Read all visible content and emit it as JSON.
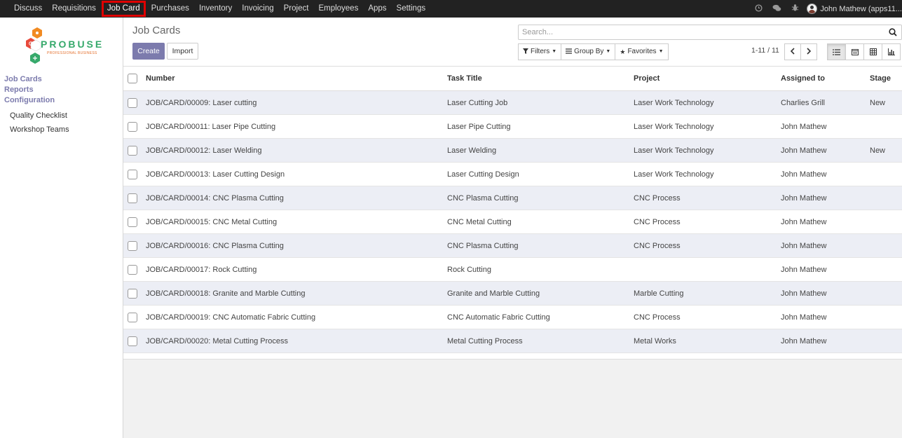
{
  "topbar": {
    "menu": [
      "Discuss",
      "Requisitions",
      "Job Card",
      "Purchases",
      "Inventory",
      "Invoicing",
      "Project",
      "Employees",
      "Apps",
      "Settings"
    ],
    "active_index": 2,
    "user_name": "John Mathew (apps11..."
  },
  "sidebar": {
    "logo": {
      "brand": "PROBUSE",
      "tagline": "PROFESSIONAL BUSINESS"
    },
    "main_items": [
      "Job Cards",
      "Reports",
      "Configuration"
    ],
    "sub_items": [
      "Quality Checklist",
      "Workshop Teams"
    ]
  },
  "control_panel": {
    "title": "Job Cards",
    "create_label": "Create",
    "import_label": "Import",
    "search_placeholder": "Search...",
    "filters_label": "Filters",
    "groupby_label": "Group By",
    "favorites_label": "Favorites",
    "pager": "1-11 / 11"
  },
  "table": {
    "headers": {
      "number": "Number",
      "task": "Task Title",
      "project": "Project",
      "assigned": "Assigned to",
      "stage": "Stage"
    },
    "rows": [
      {
        "number": "JOB/CARD/00009: Laser cutting",
        "task": "Laser Cutting Job",
        "project": "Laser Work Technology",
        "assigned": "Charlies Grill",
        "stage": "New"
      },
      {
        "number": "JOB/CARD/00011: Laser Pipe Cutting",
        "task": "Laser Pipe Cutting",
        "project": "Laser Work Technology",
        "assigned": "John Mathew",
        "stage": ""
      },
      {
        "number": "JOB/CARD/00012: Laser Welding",
        "task": "Laser Welding",
        "project": "Laser Work Technology",
        "assigned": "John Mathew",
        "stage": "New"
      },
      {
        "number": "JOB/CARD/00013: Laser Cutting Design",
        "task": "Laser Cutting Design",
        "project": "Laser Work Technology",
        "assigned": "John Mathew",
        "stage": ""
      },
      {
        "number": "JOB/CARD/00014: CNC Plasma Cutting",
        "task": "CNC Plasma Cutting",
        "project": "CNC Process",
        "assigned": "John Mathew",
        "stage": ""
      },
      {
        "number": "JOB/CARD/00015: CNC Metal Cutting",
        "task": "CNC Metal Cutting",
        "project": "CNC Process",
        "assigned": "John Mathew",
        "stage": ""
      },
      {
        "number": "JOB/CARD/00016: CNC Plasma Cutting",
        "task": "CNC Plasma Cutting",
        "project": "CNC Process",
        "assigned": "John Mathew",
        "stage": ""
      },
      {
        "number": "JOB/CARD/00017: Rock Cutting",
        "task": "Rock Cutting",
        "project": "",
        "assigned": "John Mathew",
        "stage": ""
      },
      {
        "number": "JOB/CARD/00018: Granite and Marble Cutting",
        "task": "Granite and Marble Cutting",
        "project": "Marble Cutting",
        "assigned": "John Mathew",
        "stage": ""
      },
      {
        "number": "JOB/CARD/00019: CNC Automatic Fabric Cutting",
        "task": "CNC Automatic Fabric Cutting",
        "project": "CNC Process",
        "assigned": "John Mathew",
        "stage": ""
      },
      {
        "number": "JOB/CARD/00020: Metal Cutting Process",
        "task": "Metal Cutting Process",
        "project": "Metal Works",
        "assigned": "John Mathew",
        "stage": ""
      }
    ]
  },
  "colors": {
    "topbar": "#222222",
    "accent": "#7c7bad",
    "row_alt": "#eceef5",
    "highlight": "#e00000"
  }
}
